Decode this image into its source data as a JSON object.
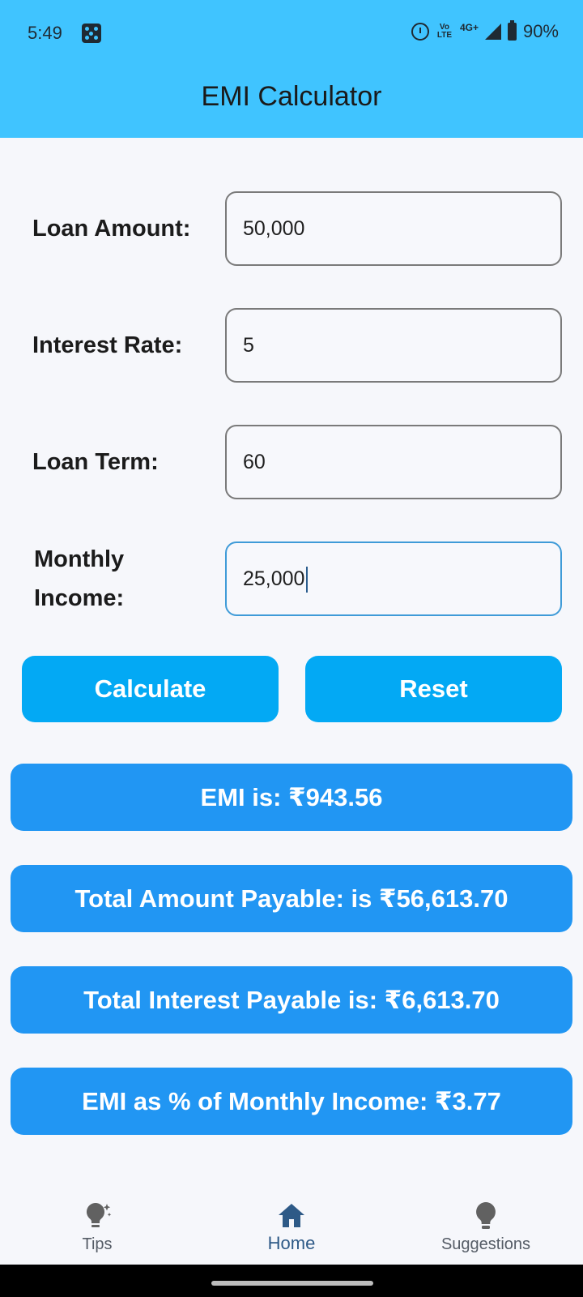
{
  "status_bar": {
    "time": "5:49",
    "volte": "Vo LTE",
    "network": "4G+",
    "battery": "90%"
  },
  "app_bar": {
    "title": "EMI Calculator"
  },
  "form": {
    "loan_amount_label": "Loan Amount:",
    "loan_amount_value": "50,000",
    "interest_rate_label": "Interest Rate:",
    "interest_rate_value": "5",
    "loan_term_label": "Loan Term:",
    "loan_term_value": "60",
    "monthly_income_label_line1": "Monthly",
    "monthly_income_label_line2": "Income:",
    "monthly_income_value": "25,000"
  },
  "buttons": {
    "calculate": "Calculate",
    "reset": "Reset"
  },
  "results": {
    "emi": "EMI is:  ₹943.56",
    "total_amount": "Total Amount Payable:  is ₹56,613.70",
    "total_interest": "Total Interest Payable is: ₹6,613.70",
    "emi_percent": "EMI as % of Monthly Income: ₹3.77"
  },
  "bottom_nav": {
    "items": [
      {
        "label": "Tips",
        "icon": "lightbulb-sparkle-icon",
        "active": false
      },
      {
        "label": "Home",
        "icon": "home-icon",
        "active": true
      },
      {
        "label": "Suggestions",
        "icon": "lightbulb-icon",
        "active": false
      }
    ]
  },
  "colors": {
    "app_bar": "#40c4ff",
    "button": "#03a9f4",
    "result": "#2196f3",
    "nav_active": "#2e5a87"
  }
}
